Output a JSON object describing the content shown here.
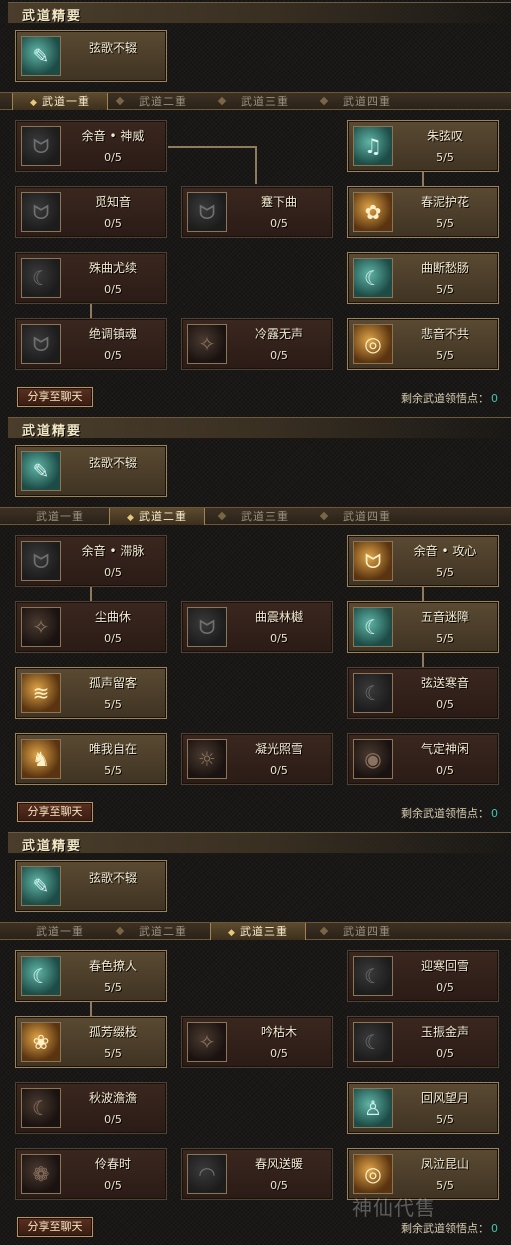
{
  "panels": [
    {
      "section_title": "武道精要",
      "essence": {
        "name": "弦歌不辍"
      },
      "tabs": [
        "武道一重",
        "武道二重",
        "武道三重",
        "武道四重"
      ],
      "active_tab": 0,
      "skills": [
        {
          "name": "余音 • 神威",
          "count": "0/5"
        },
        {
          "name": "觅知音",
          "count": "0/5"
        },
        {
          "name": "蹇下曲",
          "count": "0/5"
        },
        {
          "name": "殊曲尤续",
          "count": "0/5"
        },
        {
          "name": "绝调镇魂",
          "count": "0/5"
        },
        {
          "name": "冷露无声",
          "count": "0/5"
        },
        {
          "name": "朱弦叹",
          "count": "5/5"
        },
        {
          "name": "春泥护花",
          "count": "5/5"
        },
        {
          "name": "曲断愁肠",
          "count": "5/5"
        },
        {
          "name": "悲音不共",
          "count": "5/5"
        }
      ],
      "share_label": "分享至聊天",
      "remaining_label": "剩余武道领悟点：",
      "remaining_value": "0"
    },
    {
      "section_title": "武道精要",
      "essence": {
        "name": "弦歌不辍"
      },
      "tabs": [
        "武道一重",
        "武道二重",
        "武道三重",
        "武道四重"
      ],
      "active_tab": 1,
      "skills": [
        {
          "name": "余音 • 滞脉",
          "count": "0/5"
        },
        {
          "name": "尘曲休",
          "count": "0/5"
        },
        {
          "name": "曲震林樾",
          "count": "0/5"
        },
        {
          "name": "孤声留客",
          "count": "5/5"
        },
        {
          "name": "唯我自在",
          "count": "5/5"
        },
        {
          "name": "凝光照雪",
          "count": "0/5"
        },
        {
          "name": "余音 • 攻心",
          "count": "5/5"
        },
        {
          "name": "五音迷障",
          "count": "5/5"
        },
        {
          "name": "弦送寒音",
          "count": "0/5"
        },
        {
          "name": "气定神闲",
          "count": "0/5"
        }
      ],
      "share_label": "分享至聊天",
      "remaining_label": "剩余武道领悟点：",
      "remaining_value": "0"
    },
    {
      "section_title": "武道精要",
      "essence": {
        "name": "弦歌不辍"
      },
      "tabs": [
        "武道一重",
        "武道二重",
        "武道三重",
        "武道四重"
      ],
      "active_tab": 2,
      "skills": [
        {
          "name": "春色撩人",
          "count": "5/5"
        },
        {
          "name": "孤芳缀枝",
          "count": "5/5"
        },
        {
          "name": "吟枯木",
          "count": "0/5"
        },
        {
          "name": "秋波澹澹",
          "count": "0/5"
        },
        {
          "name": "伶春时",
          "count": "0/5"
        },
        {
          "name": "春风送暖",
          "count": "0/5"
        },
        {
          "name": "迎寒回雪",
          "count": "0/5"
        },
        {
          "name": "玉振金声",
          "count": "0/5"
        },
        {
          "name": "回风望月",
          "count": "5/5"
        },
        {
          "name": "凤泣昆山",
          "count": "5/5"
        }
      ],
      "share_label": "分享至聊天",
      "remaining_label": "剩余武道领悟点：",
      "remaining_value": "0"
    }
  ],
  "watermark": "神仙代售"
}
